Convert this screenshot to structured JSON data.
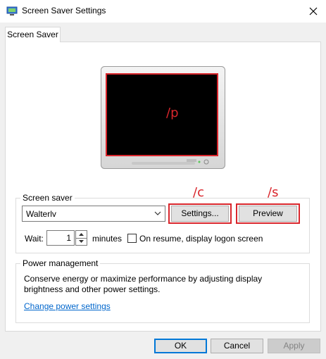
{
  "window": {
    "title": "Screen Saver Settings"
  },
  "tabs": [
    {
      "label": "Screen Saver"
    }
  ],
  "preview": {
    "annotation": "/p"
  },
  "screen_saver": {
    "legend": "Screen saver",
    "selected": "Walterlv",
    "settings_label": "Settings...",
    "preview_label": "Preview",
    "settings_annotation": "/c",
    "preview_annotation": "/s",
    "wait_label": "Wait:",
    "wait_value": "1",
    "minutes_label": "minutes",
    "on_resume_checked": false,
    "on_resume_label": "On resume, display logon screen"
  },
  "power": {
    "legend": "Power management",
    "description_line1": "Conserve energy or maximize performance by adjusting display",
    "description_line2": "brightness and other power settings.",
    "link": "Change power settings"
  },
  "buttons": {
    "ok": "OK",
    "cancel": "Cancel",
    "apply": "Apply"
  },
  "colors": {
    "annotation": "#d9262c",
    "accent": "#0078d7",
    "link": "#0066cc"
  }
}
